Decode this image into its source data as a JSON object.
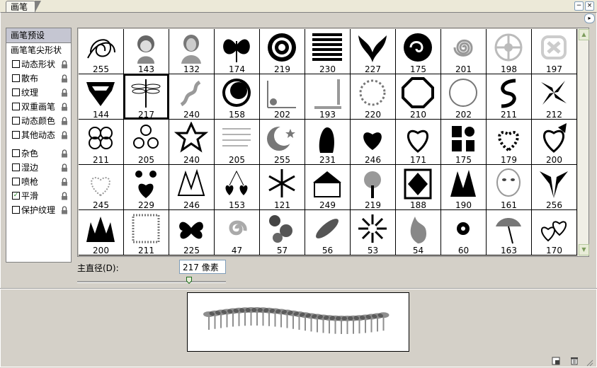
{
  "window": {
    "tab_label": "画笔",
    "minimize_label": "−",
    "close_label": "×",
    "menu_arrow_label": "▸"
  },
  "sidebar": {
    "items": [
      {
        "label": "画笔预设",
        "type": "selected"
      },
      {
        "label": "画笔笔尖形状",
        "type": "plain"
      },
      {
        "label": "动态形状",
        "type": "check",
        "checked": false,
        "lock": true
      },
      {
        "label": "散布",
        "type": "check",
        "checked": false,
        "lock": true
      },
      {
        "label": "纹理",
        "type": "check",
        "checked": false,
        "lock": true
      },
      {
        "label": "双重画笔",
        "type": "check",
        "checked": false,
        "lock": true
      },
      {
        "label": "动态颜色",
        "type": "check",
        "checked": false,
        "lock": true
      },
      {
        "label": "其他动态",
        "type": "check",
        "checked": false,
        "lock": true
      },
      {
        "label": "杂色",
        "type": "check",
        "checked": false,
        "lock": true
      },
      {
        "label": "湿边",
        "type": "check",
        "checked": false,
        "lock": true
      },
      {
        "label": "喷枪",
        "type": "check",
        "checked": false,
        "lock": true
      },
      {
        "label": "平滑",
        "type": "check",
        "checked": true,
        "lock": true
      },
      {
        "label": "保护纹理",
        "type": "check",
        "checked": false,
        "lock": true
      }
    ]
  },
  "brushes": [
    {
      "size": "255",
      "icon": "spiral-lines"
    },
    {
      "size": "143",
      "icon": "girl-portrait"
    },
    {
      "size": "132",
      "icon": "woman-portrait"
    },
    {
      "size": "174",
      "icon": "butterfly"
    },
    {
      "size": "219",
      "icon": "concentric-rings"
    },
    {
      "size": "230",
      "icon": "horizontal-stripes"
    },
    {
      "size": "227",
      "icon": "tribal-ornament"
    },
    {
      "size": "175",
      "icon": "yin-yang-swirl"
    },
    {
      "size": "201",
      "icon": "spiral"
    },
    {
      "size": "198",
      "icon": "celtic-knot"
    },
    {
      "size": "197",
      "icon": "celtic-cross"
    },
    {
      "size": "144",
      "icon": "superman-logo"
    },
    {
      "size": "217",
      "icon": "dragonfly",
      "selected": true
    },
    {
      "size": "240",
      "icon": "wavy-smoke"
    },
    {
      "size": "158",
      "icon": "crescent-circle"
    },
    {
      "size": "202",
      "icon": "floral-corner"
    },
    {
      "size": "193",
      "icon": "frame-corner"
    },
    {
      "size": "220",
      "icon": "flower-wreath"
    },
    {
      "size": "210",
      "icon": "octagon-frame"
    },
    {
      "size": "202",
      "icon": "round-frame"
    },
    {
      "size": "211",
      "icon": "swirl-s"
    },
    {
      "size": "212",
      "icon": "tribal-pinwheel"
    },
    {
      "size": "211",
      "icon": "four-knot"
    },
    {
      "size": "205",
      "icon": "triple-spiral"
    },
    {
      "size": "240",
      "icon": "star-knot"
    },
    {
      "size": "205",
      "icon": "handwriting"
    },
    {
      "size": "255",
      "icon": "moon-star"
    },
    {
      "size": "231",
      "icon": "couple-silhouette"
    },
    {
      "size": "246",
      "icon": "love-heart-text"
    },
    {
      "size": "171",
      "icon": "heart-swirl"
    },
    {
      "size": "175",
      "icon": "love-letters"
    },
    {
      "size": "179",
      "icon": "heart-dots"
    },
    {
      "size": "200",
      "icon": "heart-bow"
    },
    {
      "size": "245",
      "icon": "dotted-heart"
    },
    {
      "size": "229",
      "icon": "flower-heart"
    },
    {
      "size": "246",
      "icon": "leafy-scribble"
    },
    {
      "size": "153",
      "icon": "cherries"
    },
    {
      "size": "121",
      "icon": "snowflake"
    },
    {
      "size": "249",
      "icon": "temple-scene"
    },
    {
      "size": "219",
      "icon": "tree-scene"
    },
    {
      "size": "188",
      "icon": "aztec-pattern"
    },
    {
      "size": "190",
      "icon": "shattered-glass"
    },
    {
      "size": "161",
      "icon": "woman-face"
    },
    {
      "size": "256",
      "icon": "tribal-wings"
    },
    {
      "size": "200",
      "icon": "spiky-crown"
    },
    {
      "size": "211",
      "icon": "square-frame"
    },
    {
      "size": "225",
      "icon": "butterfly-tribal"
    },
    {
      "size": "47",
      "icon": "soft-swirl"
    },
    {
      "size": "57",
      "icon": "soft-blobs"
    },
    {
      "size": "56",
      "icon": "soft-leaves"
    },
    {
      "size": "53",
      "icon": "sunburst"
    },
    {
      "size": "54",
      "icon": "soft-flame"
    },
    {
      "size": "60",
      "icon": "small-flower"
    },
    {
      "size": "163",
      "icon": "parasol-tree"
    },
    {
      "size": "170",
      "icon": "triple-hearts"
    }
  ],
  "diameter": {
    "label": "主直径(D):",
    "value": "217 像素",
    "slider_fraction": 0.75
  },
  "scrollbar": {
    "up_label": "▲",
    "down_label": "▼"
  }
}
